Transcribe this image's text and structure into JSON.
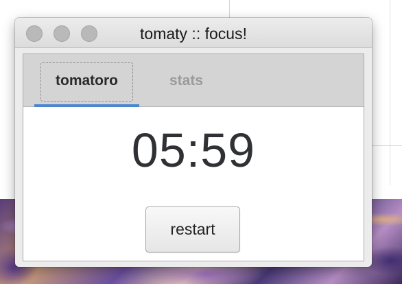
{
  "window": {
    "title": "tomaty :: focus!"
  },
  "tabs": [
    {
      "label": "tomatoro",
      "selected": true
    },
    {
      "label": "stats",
      "selected": false
    }
  ],
  "timer": {
    "display": "05:59"
  },
  "buttons": {
    "restart_label": "restart"
  },
  "colors": {
    "tab_indicator": "#4a86d0",
    "timer_text": "#2f3134",
    "inactive_tab_text": "#9a9a9a"
  },
  "icons": {
    "traffic_lights": [
      "close-icon",
      "minimize-icon",
      "maximize-icon"
    ]
  }
}
